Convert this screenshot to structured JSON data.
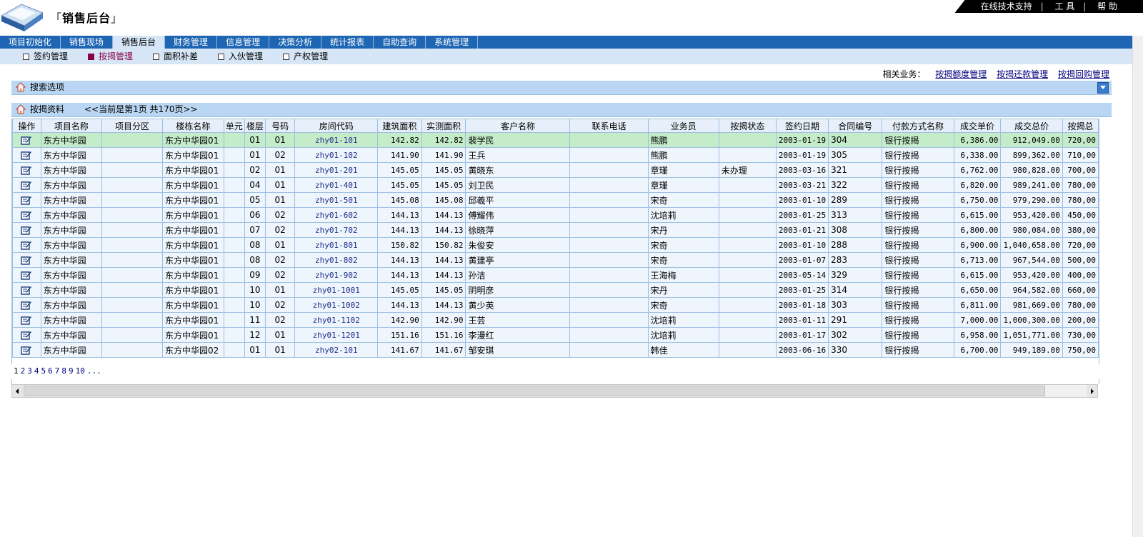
{
  "app": {
    "title": "销售后台"
  },
  "top_links": [
    "在线技术支持",
    "工 具",
    "帮 助"
  ],
  "main_nav": [
    "项目初始化",
    "销售现场",
    "销售后台",
    "财务管理",
    "信息管理",
    "决策分析",
    "统计报表",
    "自助查询",
    "系统管理"
  ],
  "main_nav_active": "销售后台",
  "sub_nav": [
    "签约管理",
    "按揭管理",
    "面积补差",
    "入伙管理",
    "产权管理"
  ],
  "sub_nav_active": "按揭管理",
  "related": {
    "label": "相关业务：",
    "links": [
      "按揭额度管理",
      "按揭还款管理",
      "按揭回购管理"
    ]
  },
  "search_panel": {
    "title": "搜索选项"
  },
  "data_panel": {
    "title": "按揭资料",
    "page_info": "<<当前是第1页 共170页>>"
  },
  "columns": [
    "操作",
    "项目名称",
    "项目分区",
    "楼栋名称",
    "单元",
    "楼层",
    "号码",
    "房间代码",
    "建筑面积",
    "实测面积",
    "客户名称",
    "联系电话",
    "业务员",
    "按揭状态",
    "签约日期",
    "合同编号",
    "付款方式名称",
    "成交单价",
    "成交总价",
    "按揭总"
  ],
  "rows": [
    [
      "东方中华园",
      "",
      "东方中华园01",
      "",
      "01",
      "01",
      "zhy01-101",
      "142.82",
      "142.82",
      "裴学民",
      "",
      "熊鹏",
      "",
      "2003-01-19",
      "304",
      "银行按揭",
      "6,386.00",
      "912,049.00",
      "720,00"
    ],
    [
      "东方中华园",
      "",
      "东方中华园01",
      "",
      "01",
      "02",
      "zhy01-102",
      "141.90",
      "141.90",
      "王兵",
      "",
      "熊鹏",
      "",
      "2003-01-19",
      "305",
      "银行按揭",
      "6,338.00",
      "899,362.00",
      "710,00"
    ],
    [
      "东方中华园",
      "",
      "东方中华园01",
      "",
      "02",
      "01",
      "zhy01-201",
      "145.05",
      "145.05",
      "黄晓东",
      "",
      "章瑾",
      "未办理",
      "2003-03-16",
      "321",
      "银行按揭",
      "6,762.00",
      "980,828.00",
      "700,00"
    ],
    [
      "东方中华园",
      "",
      "东方中华园01",
      "",
      "04",
      "01",
      "zhy01-401",
      "145.05",
      "145.05",
      "刘卫民",
      "",
      "章瑾",
      "",
      "2003-03-21",
      "322",
      "银行按揭",
      "6,820.00",
      "989,241.00",
      "780,00"
    ],
    [
      "东方中华园",
      "",
      "东方中华园01",
      "",
      "05",
      "01",
      "zhy01-501",
      "145.08",
      "145.08",
      "邱羲平",
      "",
      "宋奇",
      "",
      "2003-01-10",
      "289",
      "银行按揭",
      "6,750.00",
      "979,290.00",
      "780,00"
    ],
    [
      "东方中华园",
      "",
      "东方中华园01",
      "",
      "06",
      "02",
      "zhy01-602",
      "144.13",
      "144.13",
      "傅耀伟",
      "",
      "沈培莉",
      "",
      "2003-01-25",
      "313",
      "银行按揭",
      "6,615.00",
      "953,420.00",
      "450,00"
    ],
    [
      "东方中华园",
      "",
      "东方中华园01",
      "",
      "07",
      "02",
      "zhy01-702",
      "144.13",
      "144.13",
      "徐晓萍",
      "",
      "宋丹",
      "",
      "2003-01-21",
      "308",
      "银行按揭",
      "6,800.00",
      "980,084.00",
      "380,00"
    ],
    [
      "东方中华园",
      "",
      "东方中华园01",
      "",
      "08",
      "01",
      "zhy01-801",
      "150.82",
      "150.82",
      "朱俊安",
      "",
      "宋奇",
      "",
      "2003-01-10",
      "288",
      "银行按揭",
      "6,900.00",
      "1,040,658.00",
      "720,00"
    ],
    [
      "东方中华园",
      "",
      "东方中华园01",
      "",
      "08",
      "02",
      "zhy01-802",
      "144.13",
      "144.13",
      "黄建亭",
      "",
      "宋奇",
      "",
      "2003-01-07",
      "283",
      "银行按揭",
      "6,713.00",
      "967,544.00",
      "500,00"
    ],
    [
      "东方中华园",
      "",
      "东方中华园01",
      "",
      "09",
      "02",
      "zhy01-902",
      "144.13",
      "144.13",
      "孙洁",
      "",
      "王海梅",
      "",
      "2003-05-14",
      "329",
      "银行按揭",
      "6,615.00",
      "953,420.00",
      "400,00"
    ],
    [
      "东方中华园",
      "",
      "东方中华园01",
      "",
      "10",
      "01",
      "zhy01-1001",
      "145.05",
      "145.05",
      "阴明彦",
      "",
      "宋丹",
      "",
      "2003-01-25",
      "314",
      "银行按揭",
      "6,650.00",
      "964,582.00",
      "660,00"
    ],
    [
      "东方中华园",
      "",
      "东方中华园01",
      "",
      "10",
      "02",
      "zhy01-1002",
      "144.13",
      "144.13",
      "黄少英",
      "",
      "宋奇",
      "",
      "2003-01-18",
      "303",
      "银行按揭",
      "6,811.00",
      "981,669.00",
      "780,00"
    ],
    [
      "东方中华园",
      "",
      "东方中华园01",
      "",
      "11",
      "02",
      "zhy01-1102",
      "142.90",
      "142.90",
      "王芸",
      "",
      "沈培莉",
      "",
      "2003-01-11",
      "291",
      "银行按揭",
      "7,000.00",
      "1,000,300.00",
      "200,00"
    ],
    [
      "东方中华园",
      "",
      "东方中华园01",
      "",
      "12",
      "01",
      "zhy01-1201",
      "151.16",
      "151.16",
      "李漫红",
      "",
      "沈培莉",
      "",
      "2003-01-17",
      "302",
      "银行按揭",
      "6,958.00",
      "1,051,771.00",
      "730,00"
    ],
    [
      "东方中华园",
      "",
      "东方中华园02",
      "",
      "01",
      "01",
      "zhy02-101",
      "141.67",
      "141.67",
      "邹安琪",
      "",
      "韩佳",
      "",
      "2003-06-16",
      "330",
      "银行按揭",
      "6,700.00",
      "949,189.00",
      "750,00"
    ]
  ],
  "pager": [
    "1",
    "2",
    "3",
    "4",
    "5",
    "6",
    "7",
    "8",
    "9",
    "10",
    "..."
  ]
}
